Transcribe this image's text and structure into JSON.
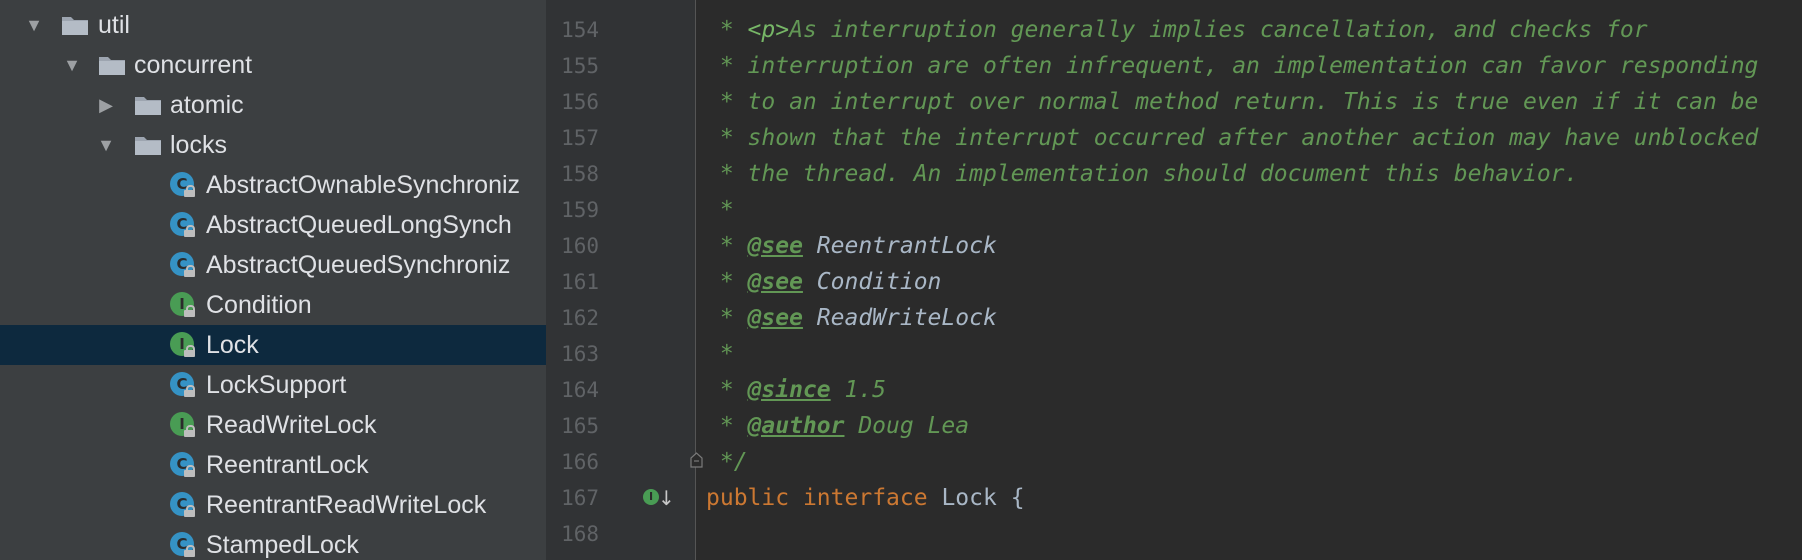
{
  "project_tree": {
    "folders": [
      {
        "label": "util",
        "icon": "folder-icon",
        "expanded": true
      },
      {
        "label": "concurrent",
        "icon": "folder-icon",
        "expanded": true
      },
      {
        "label": "atomic",
        "icon": "folder-icon",
        "expanded": false
      },
      {
        "label": "locks",
        "icon": "folder-icon",
        "expanded": true
      }
    ],
    "files": [
      {
        "label": "AbstractOwnableSynchroniz",
        "kind": "abstract-class",
        "badge": "C"
      },
      {
        "label": "AbstractQueuedLongSynch",
        "kind": "abstract-class",
        "badge": "C"
      },
      {
        "label": "AbstractQueuedSynchroniz",
        "kind": "abstract-class",
        "badge": "C"
      },
      {
        "label": "Condition",
        "kind": "interface",
        "badge": "I"
      },
      {
        "label": "Lock",
        "kind": "interface",
        "badge": "I",
        "selected": true
      },
      {
        "label": "LockSupport",
        "kind": "class",
        "badge": "C"
      },
      {
        "label": "ReadWriteLock",
        "kind": "interface",
        "badge": "I"
      },
      {
        "label": "ReentrantLock",
        "kind": "class",
        "badge": "C"
      },
      {
        "label": "ReentrantReadWriteLock",
        "kind": "class",
        "badge": "C"
      },
      {
        "label": "StampedLock",
        "kind": "class",
        "badge": "C"
      }
    ]
  },
  "editor": {
    "line_numbers": [
      "154",
      "155",
      "156",
      "157",
      "158",
      "159",
      "160",
      "161",
      "162",
      "163",
      "164",
      "165",
      "166",
      "167",
      "168"
    ],
    "lines": {
      "l154": {
        "star": " * ",
        "html": "<p>",
        "text": "As interruption generally implies cancellation, and checks for"
      },
      "l155": " * interruption are often infrequent, an implementation can favor responding",
      "l156": " * to an interrupt over normal method return. This is true even if it can be",
      "l157": " * shown that the interrupt occurred after another action may have unblocked",
      "l158": " * the thread. An implementation should document this behavior.",
      "l159": " *",
      "l160": {
        "star": " * ",
        "tag": "@see",
        "ref": " ReentrantLock"
      },
      "l161": {
        "star": " * ",
        "tag": "@see",
        "ref": " Condition"
      },
      "l162": {
        "star": " * ",
        "tag": "@see",
        "ref": " ReadWriteLock"
      },
      "l163": " *",
      "l164": {
        "star": " * ",
        "tag": "@since",
        "text": " 1.5"
      },
      "l165": {
        "star": " * ",
        "tag": "@author",
        "text": " Doug Lea"
      },
      "l166": " */",
      "l167": {
        "kw1": "public",
        "kw2": "interface",
        "name": "Lock",
        "brace": "{"
      }
    },
    "gutter_icons": [
      "implemented-interface-icon",
      "fold-marker-icon"
    ],
    "colors": {
      "doc_comment": "#629755",
      "keyword": "#cc7832",
      "identifier": "#a9b7c6",
      "selection": "#0d293e"
    }
  }
}
